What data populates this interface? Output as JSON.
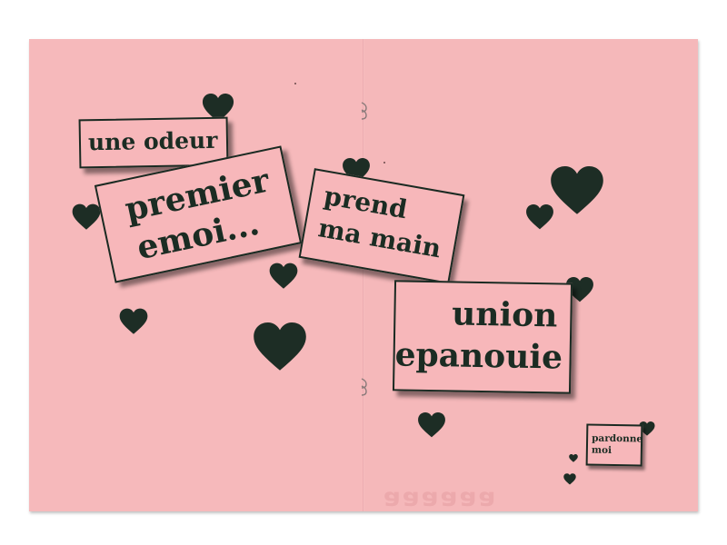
{
  "colors": {
    "paper": "#f6b9bb",
    "ink": "#1d2d25",
    "background": "#ffffff"
  },
  "cards": {
    "odeur": "une odeur",
    "emoi_line1": "premier",
    "emoi_line2": "emoi...",
    "main_line1": "prend",
    "main_line2": "ma main",
    "union_line1": "union",
    "union_line2": "epanouie",
    "pardonne_line1": "pardonne",
    "pardonne_line2": "moi"
  },
  "icons": {
    "heart": "heart-icon",
    "staple": "staple-icon"
  }
}
